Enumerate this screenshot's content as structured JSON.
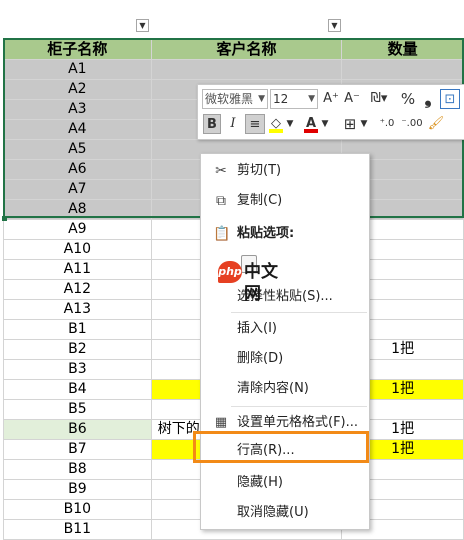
{
  "header": {
    "col_a": "柜子名称",
    "col_b": "客户名称",
    "col_c": "数量"
  },
  "rows": [
    {
      "a": "A1",
      "c": "",
      "q": ""
    },
    {
      "a": "A2",
      "c": "",
      "q": ""
    },
    {
      "a": "A3",
      "c": "",
      "q": ""
    },
    {
      "a": "A4",
      "c": "",
      "q": ""
    },
    {
      "a": "A5",
      "c": "",
      "q": ""
    },
    {
      "a": "A6",
      "c": "",
      "q": ""
    },
    {
      "a": "A7",
      "c": "",
      "q": ""
    },
    {
      "a": "A8",
      "c": "",
      "q": ""
    },
    {
      "a": "A9",
      "c": "",
      "q": ""
    },
    {
      "a": "A10",
      "c": "",
      "q": ""
    },
    {
      "a": "A11",
      "c": "",
      "q": ""
    },
    {
      "a": "A12",
      "c": "",
      "q": ""
    },
    {
      "a": "A13",
      "c": "",
      "q": ""
    },
    {
      "a": "B1",
      "c": "",
      "q": ""
    },
    {
      "a": "B2",
      "c": "",
      "q": "1把"
    },
    {
      "a": "B3",
      "c": "",
      "q": ""
    },
    {
      "a": "B4",
      "c": "",
      "q": "1把"
    },
    {
      "a": "B5",
      "c": "",
      "q": ""
    },
    {
      "a": "B6",
      "c": "树下的",
      "q": "1把"
    },
    {
      "a": "B7",
      "c": "",
      "q": "1把"
    },
    {
      "a": "B8",
      "c": "",
      "q": ""
    },
    {
      "a": "B9",
      "c": "",
      "q": ""
    },
    {
      "a": "B10",
      "c": "",
      "q": ""
    },
    {
      "a": "B11",
      "c": "",
      "q": ""
    }
  ],
  "toolbar": {
    "font_name": "微软雅黑",
    "font_size": "12",
    "grow": "A⁺",
    "shrink": "A⁻",
    "percent": "%",
    "comma": "❟",
    "bold": "B",
    "italic": "I",
    "align": "≡",
    "fill_color": "◇",
    "font_color": "A",
    "borders": "⊞",
    "dec_up": "⁺.0",
    "dec_down": "⁻.00",
    "brush": "🖌"
  },
  "context_menu": {
    "cut": "剪切(T)",
    "copy": "复制(C)",
    "paste_options": "粘贴选项:",
    "paste_special": "选择性粘贴(S)...",
    "insert": "插入(I)",
    "delete": "删除(D)",
    "clear": "清除内容(N)",
    "format_cells": "设置单元格格式(F)...",
    "row_height": "行高(R)...",
    "hide": "隐藏(H)",
    "unhide": "取消隐藏(U)"
  },
  "watermark": {
    "logo": "php",
    "text": "中文网"
  },
  "colors": {
    "header_bg": "#a9c98d",
    "selection": "#c8c8c8",
    "yellow": "#ffff00",
    "highlight": "#f28a17",
    "green_cell": "#e2efda"
  }
}
